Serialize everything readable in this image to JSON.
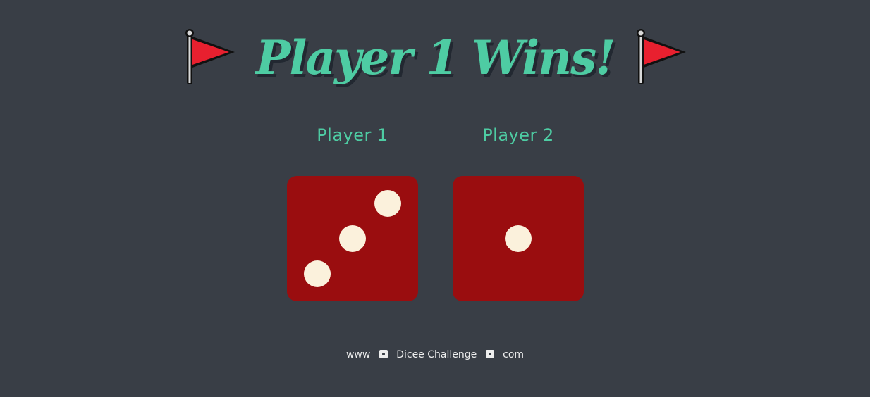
{
  "title": {
    "text": "Player 1 Wins!",
    "left_icon": "red-flag-icon",
    "right_icon": "red-flag-icon",
    "color": "#4ECCA3"
  },
  "players": [
    {
      "label": "Player 1",
      "die_value": 3
    },
    {
      "label": "Player 2",
      "die_value": 1
    }
  ],
  "die_color": "#9A0D0F",
  "pip_color": "#FBF1DC",
  "background_color": "#393E46",
  "footer": {
    "parts": [
      "www",
      "Dicee Challenge",
      "com"
    ],
    "separator_icon": "dice-icon"
  }
}
